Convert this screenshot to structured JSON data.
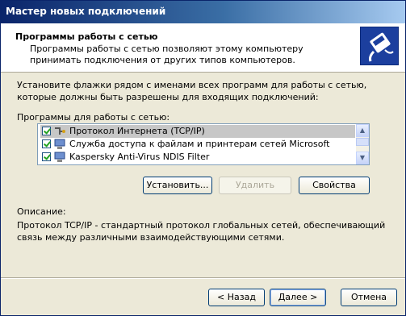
{
  "window": {
    "title": "Мастер новых подключений"
  },
  "header": {
    "title": "Программы работы с сетью",
    "subtitle": "Программы работы с сетью позволяют этому компьютеру принимать подключения от других типов компьютеров."
  },
  "instructions": "Установите флажки рядом с именами всех программ для работы с сетью, которые должны быть разрешены для входящих подключений:",
  "list_label": "Программы для работы с сетью:",
  "programs": [
    {
      "label": "Протокол Интернета (TCP/IP)",
      "checked": true,
      "selected": true,
      "icon": "network-protocol-icon"
    },
    {
      "label": "Служба доступа к файлам и принтерам сетей Microsoft",
      "checked": true,
      "selected": false,
      "icon": "network-service-icon"
    },
    {
      "label": "Kaspersky Anti-Virus NDIS Filter",
      "checked": true,
      "selected": false,
      "icon": "network-service-icon"
    }
  ],
  "buttons": {
    "install": "Установить...",
    "remove": "Удалить",
    "properties": "Свойства",
    "back": "< Назад",
    "next": "Далее >",
    "cancel": "Отмена"
  },
  "description": {
    "label": "Описание:",
    "text": "Протокол TCP/IP - стандартный протокол глобальных сетей, обеспечивающий связь между различными взаимодействующими сетями."
  },
  "colors": {
    "title_bar": "#0a246a",
    "dialog_bg": "#ece9d8",
    "selected_row": "#c7c7c7"
  }
}
